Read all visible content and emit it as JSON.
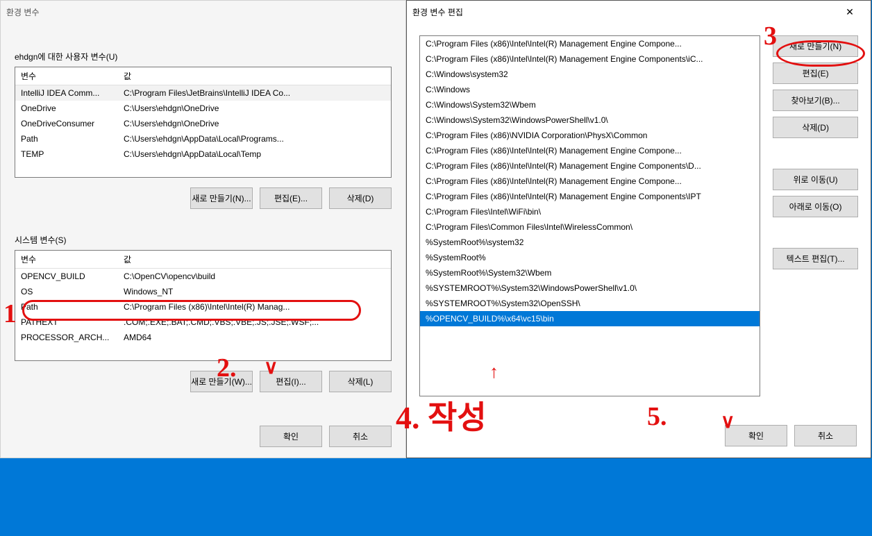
{
  "env_window": {
    "title": "환경 변수",
    "user_label": "ehdgn에 대한 사용자 변수(U)",
    "system_label": "시스템 변수(S)",
    "col_var": "변수",
    "col_val": "값",
    "user_rows": [
      {
        "var": "IntelliJ IDEA Comm...",
        "val": "C:\\Program Files\\JetBrains\\IntelliJ IDEA Co..."
      },
      {
        "var": "OneDrive",
        "val": "C:\\Users\\ehdgn\\OneDrive"
      },
      {
        "var": "OneDriveConsumer",
        "val": "C:\\Users\\ehdgn\\OneDrive"
      },
      {
        "var": "Path",
        "val": "C:\\Users\\ehdgn\\AppData\\Local\\Programs..."
      },
      {
        "var": "TEMP",
        "val": "C:\\Users\\ehdgn\\AppData\\Local\\Temp"
      }
    ],
    "system_rows": [
      {
        "var": "OPENCV_BUILD",
        "val": "C:\\OpenCV\\opencv\\build"
      },
      {
        "var": "OS",
        "val": "Windows_NT"
      },
      {
        "var": "Path",
        "val": "C:\\Program Files (x86)\\Intel\\Intel(R) Manag..."
      },
      {
        "var": "PATHEXT",
        "val": ".COM;.EXE;.BAT;.CMD;.VBS;.VBE;.JS;.JSE;.WSF;..."
      },
      {
        "var": "PROCESSOR_ARCH...",
        "val": "AMD64"
      }
    ],
    "btn_new_u": "새로 만들기(N)...",
    "btn_edit_u": "편집(E)...",
    "btn_delete_u": "삭제(D)",
    "btn_new_s": "새로 만들기(W)...",
    "btn_edit_s": "편집(I)...",
    "btn_delete_s": "삭제(L)",
    "btn_ok": "확인",
    "btn_cancel": "취소"
  },
  "edit_window": {
    "title": "환경 변수 편집",
    "paths": [
      "C:\\Program Files (x86)\\Intel\\Intel(R) Management Engine Compone...",
      "C:\\Program Files (x86)\\Intel\\Intel(R) Management Engine Components\\iC...",
      "C:\\Windows\\system32",
      "C:\\Windows",
      "C:\\Windows\\System32\\Wbem",
      "C:\\Windows\\System32\\WindowsPowerShell\\v1.0\\",
      "C:\\Program Files (x86)\\NVIDIA Corporation\\PhysX\\Common",
      "C:\\Program Files (x86)\\Intel\\Intel(R) Management Engine Compone...",
      "C:\\Program Files (x86)\\Intel\\Intel(R) Management Engine Components\\D...",
      "C:\\Program Files (x86)\\Intel\\Intel(R) Management Engine Compone...",
      "C:\\Program Files (x86)\\Intel\\Intel(R) Management Engine Components\\IPT",
      "C:\\Program Files\\Intel\\WiFi\\bin\\",
      "C:\\Program Files\\Common Files\\Intel\\WirelessCommon\\",
      "%SystemRoot%\\system32",
      "%SystemRoot%",
      "%SystemRoot%\\System32\\Wbem",
      "%SYSTEMROOT%\\System32\\WindowsPowerShell\\v1.0\\",
      "%SYSTEMROOT%\\System32\\OpenSSH\\",
      "%OPENCV_BUILD%\\x64\\vc15\\bin"
    ],
    "selected_index": 18,
    "btn_new": "새로 만들기(N)",
    "btn_edit": "편집(E)",
    "btn_browse": "찾아보기(B)...",
    "btn_delete": "삭제(D)",
    "btn_up": "위로 이동(U)",
    "btn_down": "아래로 이동(O)",
    "btn_text": "텍스트 편집(T)...",
    "btn_ok": "확인",
    "btn_cancel": "취소"
  },
  "annotations": {
    "a1": "1",
    "a2": "2.",
    "a3": "3",
    "a4": "4. 작성",
    "a5": "5.",
    "check": "∨",
    "arrow": "↑"
  }
}
